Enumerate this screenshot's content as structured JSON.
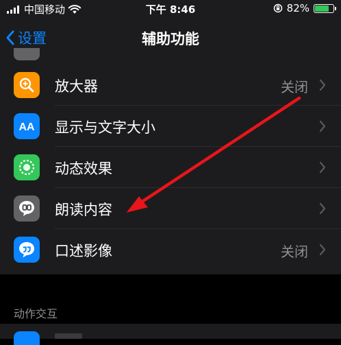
{
  "status_bar": {
    "carrier": "中国移动",
    "time": "下午 8:46",
    "battery_percent": "82%",
    "battery_level": 0.82
  },
  "nav": {
    "back_label": "设置",
    "title": "辅助功能"
  },
  "rows": [
    {
      "label": "放大器",
      "value": "关闭",
      "icon": "magnifier-icon",
      "color": "#ff9500"
    },
    {
      "label": "显示与文字大小",
      "value": "",
      "icon": "text-size-icon",
      "color": "#0a84ff"
    },
    {
      "label": "动态效果",
      "value": "",
      "icon": "motion-icon",
      "color": "#34c759"
    },
    {
      "label": "朗读内容",
      "value": "",
      "icon": "speech-bubble-icon",
      "color": "#636366"
    },
    {
      "label": "口述影像",
      "value": "关闭",
      "icon": "audio-description-icon",
      "color": "#0a84ff"
    }
  ],
  "section2": {
    "header": "动作交互"
  },
  "annotation": {
    "arrow_color": "#e8151b"
  }
}
